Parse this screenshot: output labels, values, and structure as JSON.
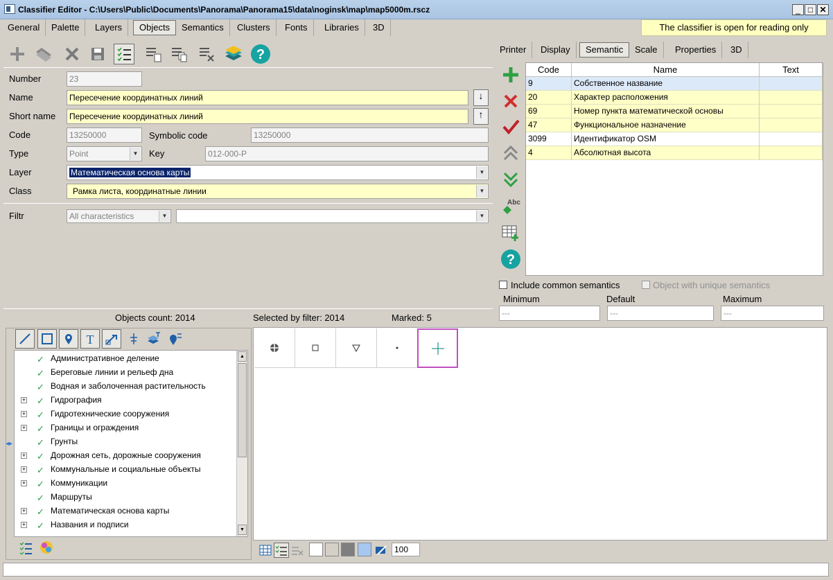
{
  "window": {
    "title": "Classifier Editor - C:\\Users\\Public\\Documents\\Panorama\\Panorama15\\data\\noginsk\\map\\map5000m.rscz"
  },
  "main_tabs": [
    "General",
    "Palette",
    "Layers",
    "Objects",
    "Semantics",
    "Clusters",
    "Fonts",
    "Libraries",
    "3D"
  ],
  "status_note": "The classifier is open for reading only",
  "form": {
    "number_label": "Number",
    "number": "23",
    "name_label": "Name",
    "name": "Пересечение координатных линий",
    "short_label": "Short name",
    "short_name": "Пересечение координатных линий",
    "code_label": "Code",
    "code": "13250000",
    "symcode_label": "Symbolic code",
    "symcode": "13250000",
    "type_label": "Type",
    "type": "Point",
    "key_label": "Key",
    "key": "012-000-P",
    "layer_label": "Layer",
    "layer": "Математическая основа карты",
    "class_label": "Class",
    "class": "Рамка листа, координатные линии",
    "filtr_label": "Filtr",
    "filtr": "All characteristics"
  },
  "counts": {
    "objects": "Objects count: 2014",
    "selected": "Selected by filter: 2014",
    "marked": "Marked: 5"
  },
  "right_tabs": [
    "Printer",
    "Display",
    "Semantic",
    "Scale",
    "Properties",
    "3D"
  ],
  "semantic_table": {
    "headers": [
      "Code",
      "Name",
      "Text"
    ],
    "rows": [
      {
        "code": "9",
        "name": "Собственное название",
        "text": ""
      },
      {
        "code": "20",
        "name": "Характер расположения",
        "text": ""
      },
      {
        "code": "69",
        "name": "Номер пункта математической основы",
        "text": ""
      },
      {
        "code": "47",
        "name": "Функциональное назначение",
        "text": ""
      },
      {
        "code": "3099",
        "name": "Идентификатор OSM",
        "text": ""
      },
      {
        "code": "4",
        "name": "Абсолютная высота",
        "text": ""
      }
    ]
  },
  "checks": {
    "include_common": "Include common semantics",
    "unique": "Object with unique semantics"
  },
  "limits": {
    "min_label": "Minimum",
    "default_label": "Default",
    "max_label": "Maximum",
    "min": "---",
    "default": "---",
    "max": "---"
  },
  "tree_items": [
    {
      "label": "Административное деление",
      "expandable": false
    },
    {
      "label": "Береговые линии и рельеф дна",
      "expandable": false
    },
    {
      "label": "Водная и заболоченная растительность",
      "expandable": false
    },
    {
      "label": "Гидрография",
      "expandable": true
    },
    {
      "label": "Гидротехнические сооружения",
      "expandable": true
    },
    {
      "label": "Границы и ограждения",
      "expandable": true
    },
    {
      "label": "Грунты",
      "expandable": false
    },
    {
      "label": "Дорожная сеть, дорожные сооружения",
      "expandable": true
    },
    {
      "label": "Коммунальные и социальные объекты",
      "expandable": true
    },
    {
      "label": "Коммуникации",
      "expandable": true
    },
    {
      "label": "Маршруты",
      "expandable": false
    },
    {
      "label": "Математическая основа карты",
      "expandable": true
    },
    {
      "label": "Названия и подписи",
      "expandable": true
    }
  ],
  "zoom": "100",
  "colors": {
    "accent_green": "#2ea043",
    "red": "#d03030",
    "yellow_field": "#ffffc8",
    "selection": "#0a246a"
  }
}
